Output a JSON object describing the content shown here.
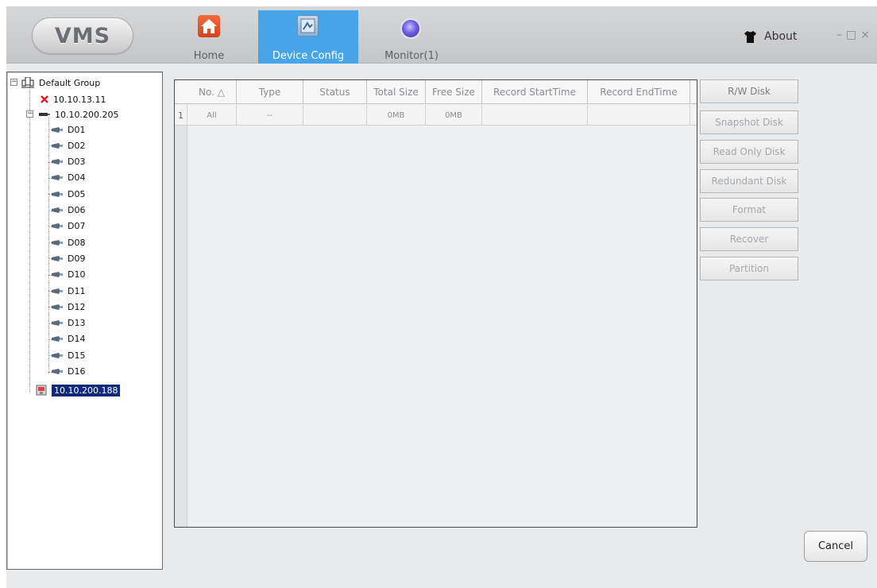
{
  "app": {
    "logo": "VMS"
  },
  "nav": {
    "tabs": [
      {
        "label": "Home",
        "icon": "home-icon",
        "active": false
      },
      {
        "label": "Device Config",
        "icon": "device-config-icon",
        "active": true
      },
      {
        "label": "Monitor(1)",
        "icon": "monitor-icon",
        "active": false
      }
    ],
    "active_color": "#46a4e8"
  },
  "header": {
    "about_label": "About",
    "about_icon": "tshirt-icon",
    "window_controls": [
      "–",
      "□",
      "×"
    ]
  },
  "tree": {
    "root": {
      "label": "Default Group",
      "icon": "group-icon",
      "expanded": true
    },
    "devices": [
      {
        "label": "10.10.13.11",
        "icon": "offline-device-icon",
        "status": "offline"
      },
      {
        "label": "10.10.200.205",
        "icon": "nvr-device-icon",
        "expanded": true,
        "channels": [
          "D01",
          "D02",
          "D03",
          "D04",
          "D05",
          "D06",
          "D07",
          "D08",
          "D09",
          "D10",
          "D11",
          "D12",
          "D13",
          "D14",
          "D15",
          "D16"
        ]
      },
      {
        "label": "10.10.200.188",
        "icon": "selected-device-icon",
        "selected": true
      }
    ],
    "selection_color": "#11297a"
  },
  "table": {
    "columns": [
      "No. △",
      "Type",
      "Status",
      "Total Size",
      "Free Size",
      "Record StartTime",
      "Record EndTime"
    ],
    "rows": [
      {
        "row_number": "1",
        "cells": [
          "All",
          "--",
          "",
          "0MB",
          "0MB",
          "",
          ""
        ]
      }
    ]
  },
  "disk_buttons": [
    "R/W Disk",
    "Snapshot Disk",
    "Read Only Disk",
    "Redundant Disk",
    "Format",
    "Recover",
    "Partition"
  ],
  "footer": {
    "cancel_label": "Cancel"
  }
}
